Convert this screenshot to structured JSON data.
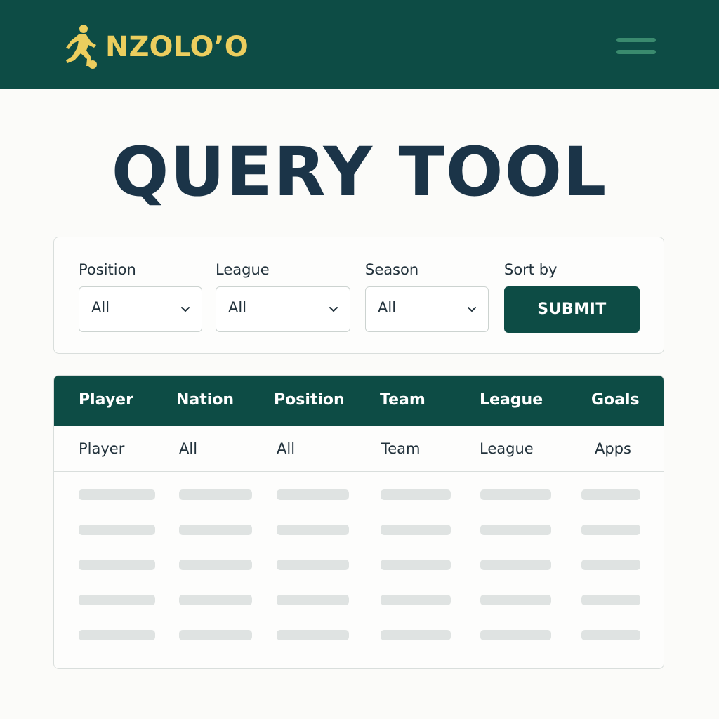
{
  "header": {
    "brand_name": "NZOLO’O",
    "logo_icon": "soccer-player-icon",
    "menu_icon": "hamburger-menu-icon",
    "colors": {
      "background": "#0d4c45",
      "brand": "#ecce5e"
    }
  },
  "page": {
    "title": "QUERY TOOL"
  },
  "filters": {
    "position": {
      "label": "Position",
      "value": "All"
    },
    "league": {
      "label": "League",
      "value": "All"
    },
    "season": {
      "label": "Season",
      "value": "All"
    },
    "sort_by": {
      "label": "Sort by"
    },
    "submit_label": "SUBMIT"
  },
  "table": {
    "columns": [
      "Player",
      "Nation",
      "Position",
      "Team",
      "League",
      "Goals"
    ],
    "filter_row": [
      "Player",
      "All",
      "All",
      "Team",
      "League",
      "Apps"
    ],
    "placeholder_row_count": 5,
    "colors": {
      "header": "#0d4c45",
      "placeholder": "#dfe3e2"
    }
  }
}
